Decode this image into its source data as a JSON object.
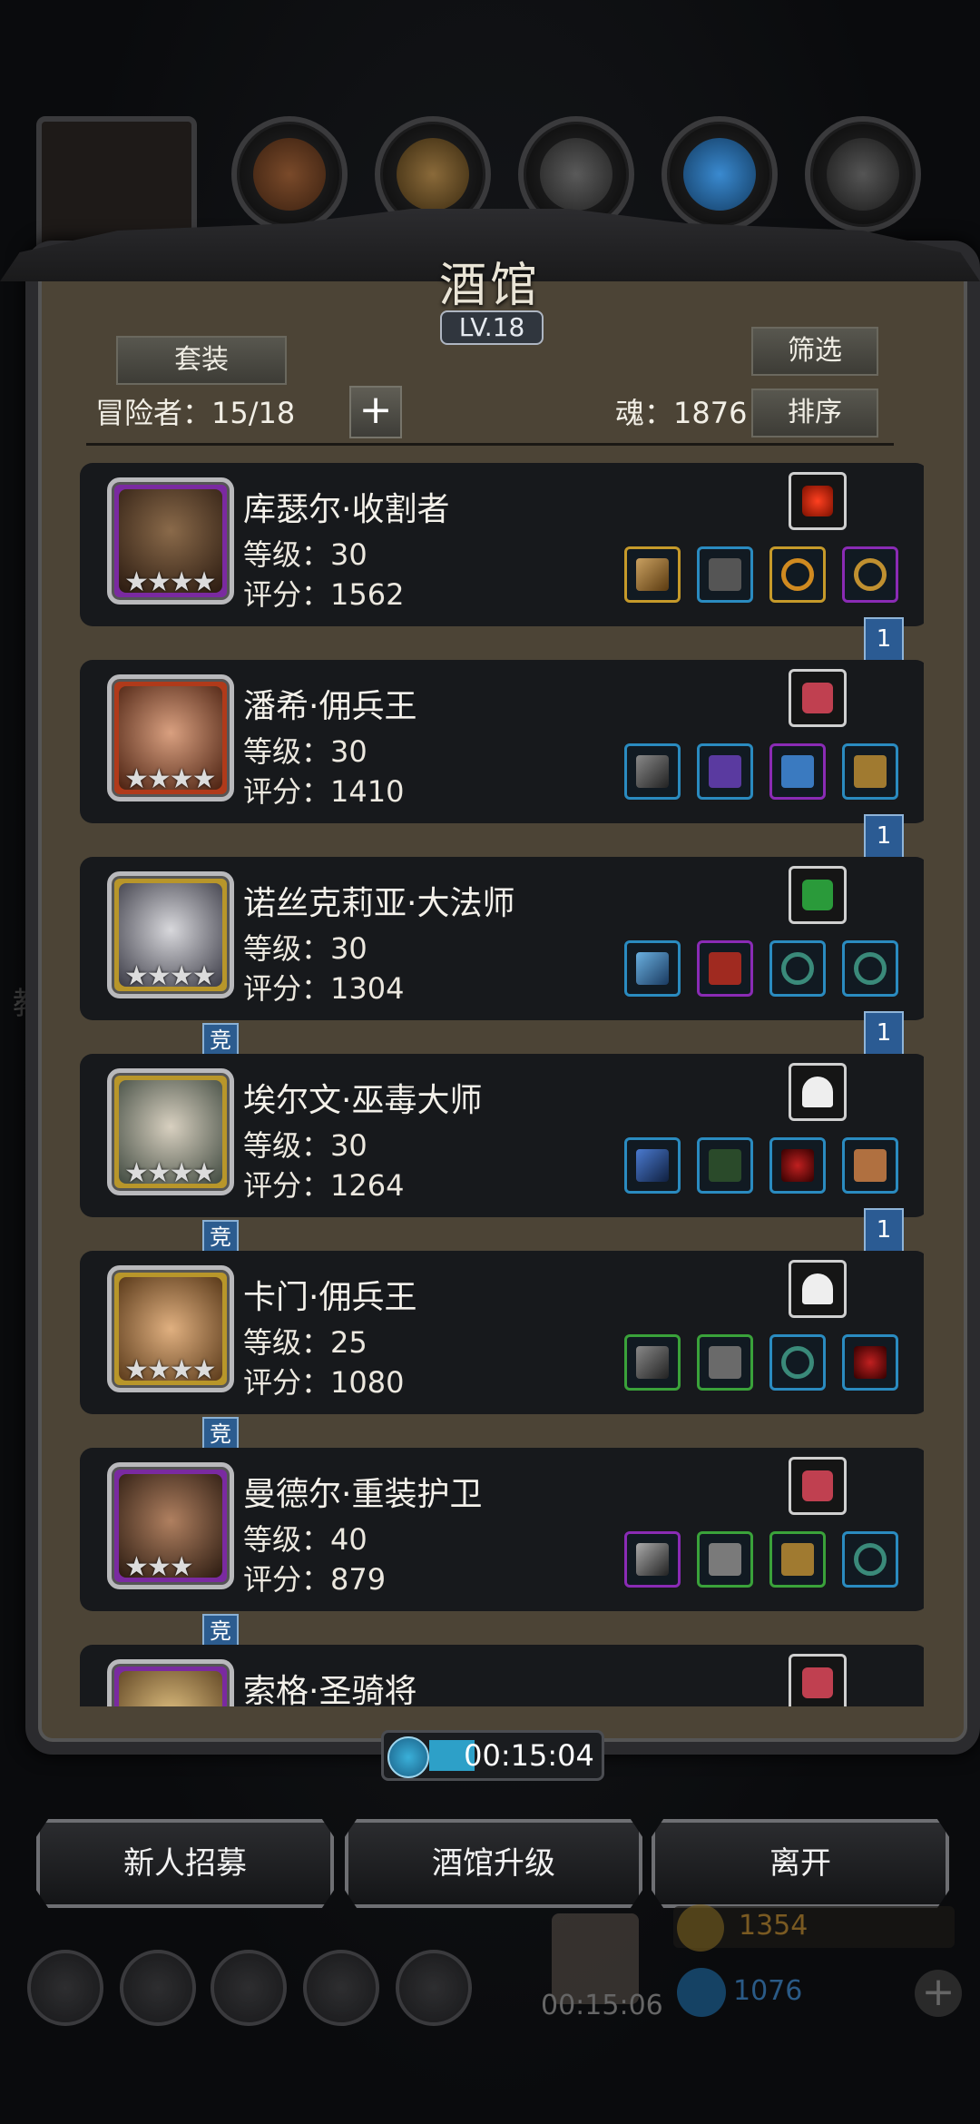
{
  "title": "酒馆",
  "level": "LV.18",
  "buttons": {
    "set": "套装",
    "filter": "筛选",
    "sort": "排序",
    "add": "+"
  },
  "adventurers_label": "冒险者：15/18",
  "soul_label": "魂：1876",
  "heroes": [
    {
      "name": "库瑟尔·收割者",
      "level": "等级：30",
      "score": "评分：1562",
      "stars": "★★★★",
      "badge": "1",
      "arena": ""
    },
    {
      "name": "潘希·佣兵王",
      "level": "等级：30",
      "score": "评分：1410",
      "stars": "★★★★",
      "badge": "1",
      "arena": ""
    },
    {
      "name": "诺丝克莉亚·大法师",
      "level": "等级：30",
      "score": "评分：1304",
      "stars": "★★★★",
      "badge": "1",
      "arena": "竞"
    },
    {
      "name": "埃尔文·巫毒大师",
      "level": "等级：30",
      "score": "评分：1264",
      "stars": "★★★★",
      "badge": "1",
      "arena": "竞"
    },
    {
      "name": "卡门·佣兵王",
      "level": "等级：25",
      "score": "评分：1080",
      "stars": "★★★★",
      "badge": "",
      "arena": "竞"
    },
    {
      "name": "曼德尔·重装护卫",
      "level": "等级：40",
      "score": "评分：879",
      "stars": "★★★",
      "badge": "",
      "arena": "竞"
    },
    {
      "name": "索格·圣骑将",
      "level": "",
      "score": "",
      "stars": "",
      "badge": "",
      "arena": ""
    }
  ],
  "timer": "00:15:04",
  "actions": {
    "recruit": "新人招募",
    "upgrade": "酒馆升级",
    "leave": "离开"
  },
  "bottom": {
    "gift_timer": "00:15:06",
    "gold": "1354",
    "gems": "1076",
    "plus": "+"
  },
  "colors": {
    "panel": "#4c4436",
    "card": "#17191c",
    "purple_rarity": "#8a2bb5",
    "blue_rarity": "#2a8bc0",
    "green_rarity": "#3aa23a",
    "gold_rarity": "#c69a2a"
  }
}
